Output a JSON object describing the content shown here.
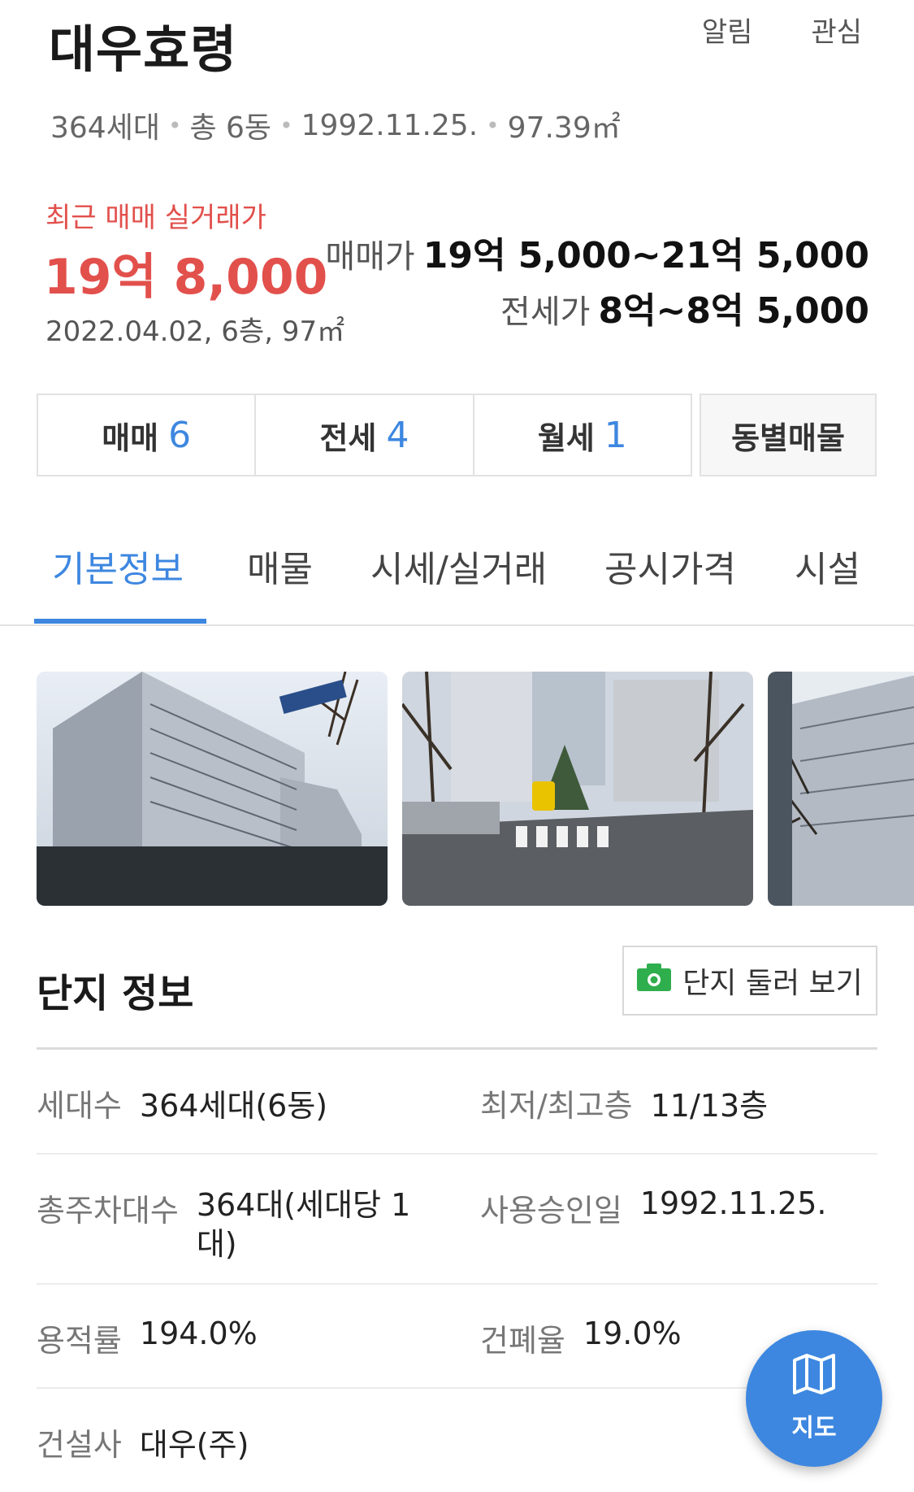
{
  "header": {
    "title": "대우효령",
    "actions": [
      "알림",
      "관심"
    ],
    "meta": [
      "364세대",
      "총 6동",
      "1992.11.25.",
      "97.39㎡"
    ]
  },
  "price": {
    "recent_label": "최근 매매 실거래가",
    "recent_value": "19억 8,000",
    "recent_detail": "2022.04.02, 6층, 97㎡",
    "sale_label": "매매가",
    "sale_range": "19억 5,000~21억 5,000",
    "jeonse_label": "전세가",
    "jeonse_range": "8억~8억 5,000"
  },
  "deal_tabs": [
    {
      "label": "매매",
      "count": "6"
    },
    {
      "label": "전세",
      "count": "4"
    },
    {
      "label": "월세",
      "count": "1"
    }
  ],
  "dong_button": "동별매물",
  "section_tabs": [
    "기본정보",
    "매물",
    "시세/실거래",
    "공시가격",
    "시설"
  ],
  "active_tab": "기본정보",
  "complex": {
    "title": "단지 정보",
    "tour_button": "단지 둘러 보기",
    "rows": [
      {
        "k1": "세대수",
        "v1": "364세대(6동)",
        "k2": "최저/최고층",
        "v2": "11/13층"
      },
      {
        "k1": "총주차대수",
        "v1": "364대(세대당 1대)",
        "k2": "사용승인일",
        "v2": "1992.11.25."
      },
      {
        "k1": "용적률",
        "v1": "194.0%",
        "k2": "건폐율",
        "v2": "19.0%"
      },
      {
        "k1": "건설사",
        "v1": "대우(주)"
      }
    ]
  },
  "map_button": "지도",
  "colors": {
    "accent": "#3d87e0",
    "price_red": "#e2504c",
    "camera_green": "#2fae4d"
  }
}
